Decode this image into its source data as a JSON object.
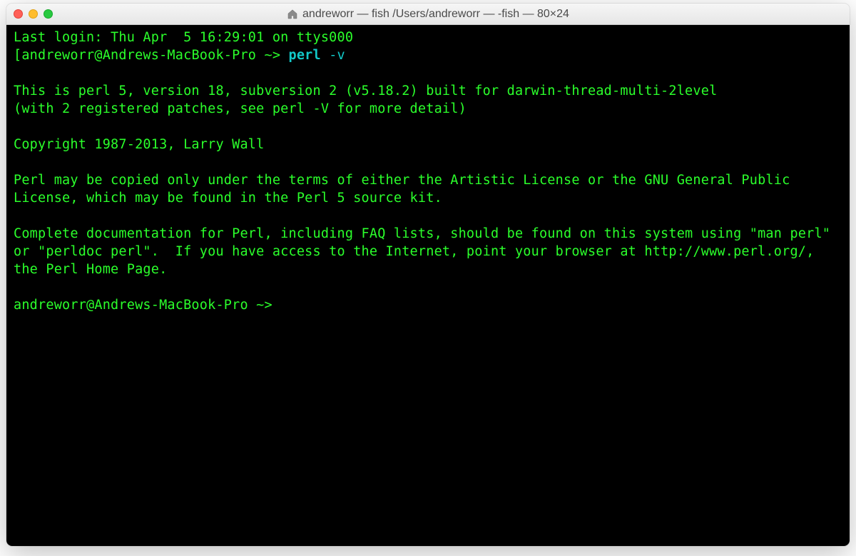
{
  "window": {
    "title": "andreworr — fish  /Users/andreworr — -fish — 80×24"
  },
  "terminal": {
    "last_login": "Last login: Thu Apr  5 16:29:01 on ttys000",
    "prompt1_open": "[",
    "prompt1_host": "andreworr@Andrews-MacBook-Pro ",
    "prompt1_arrow": "~> ",
    "cmd1_name": "perl",
    "cmd1_arg": " -v",
    "prompt1_close": "]",
    "out_line1": "This is perl 5, version 18, subversion 2 (v5.18.2) built for darwin-thread-multi-2level",
    "out_line2": "(with 2 registered patches, see perl -V for more detail)",
    "out_line3": "Copyright 1987-2013, Larry Wall",
    "out_line4": "Perl may be copied only under the terms of either the Artistic License or the GNU General Public License, which may be found in the Perl 5 source kit.",
    "out_line5": "Complete documentation for Perl, including FAQ lists, should be found on this system using \"man perl\" or \"perldoc perl\".  If you have access to the Internet, point your browser at http://www.perl.org/, the Perl Home Page.",
    "prompt2_host": "andreworr@Andrews-MacBook-Pro ",
    "prompt2_arrow": "~>"
  }
}
